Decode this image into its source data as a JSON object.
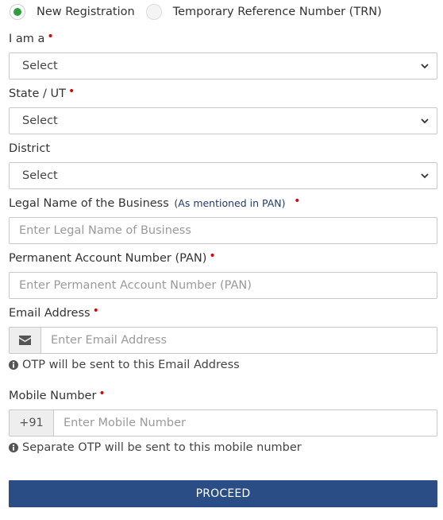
{
  "registration_type": {
    "options": [
      {
        "label": "New Registration",
        "selected": true
      },
      {
        "label": "Temporary Reference Number (TRN)",
        "selected": false
      }
    ]
  },
  "required_marker": "•",
  "fields": {
    "i_am_a": {
      "label": "I am a",
      "value": "Select",
      "required": true
    },
    "state": {
      "label": "State / UT",
      "value": "Select",
      "required": true
    },
    "district": {
      "label": "District",
      "value": "Select",
      "required": false
    },
    "legal_name": {
      "label": "Legal Name of the Business",
      "note": "(As mentioned in PAN)",
      "placeholder": "Enter Legal Name of Business",
      "required": true
    },
    "pan": {
      "label": "Permanent Account Number (PAN)",
      "placeholder": "Enter Permanent Account Number (PAN)",
      "required": true
    },
    "email": {
      "label": "Email Address",
      "placeholder": "Enter Email Address",
      "icon": "envelope-icon",
      "help": "OTP will be sent to this Email Address",
      "required": true
    },
    "mobile": {
      "label": "Mobile Number",
      "prefix": "+91",
      "placeholder": "Enter Mobile Number",
      "help": "Separate OTP will be sent to this mobile number",
      "required": true
    }
  },
  "proceed_button": {
    "label": "PROCEED"
  },
  "colors": {
    "accent": "#2b4d85",
    "radio_selected": "#2e9e3e",
    "required": "#e00000"
  }
}
